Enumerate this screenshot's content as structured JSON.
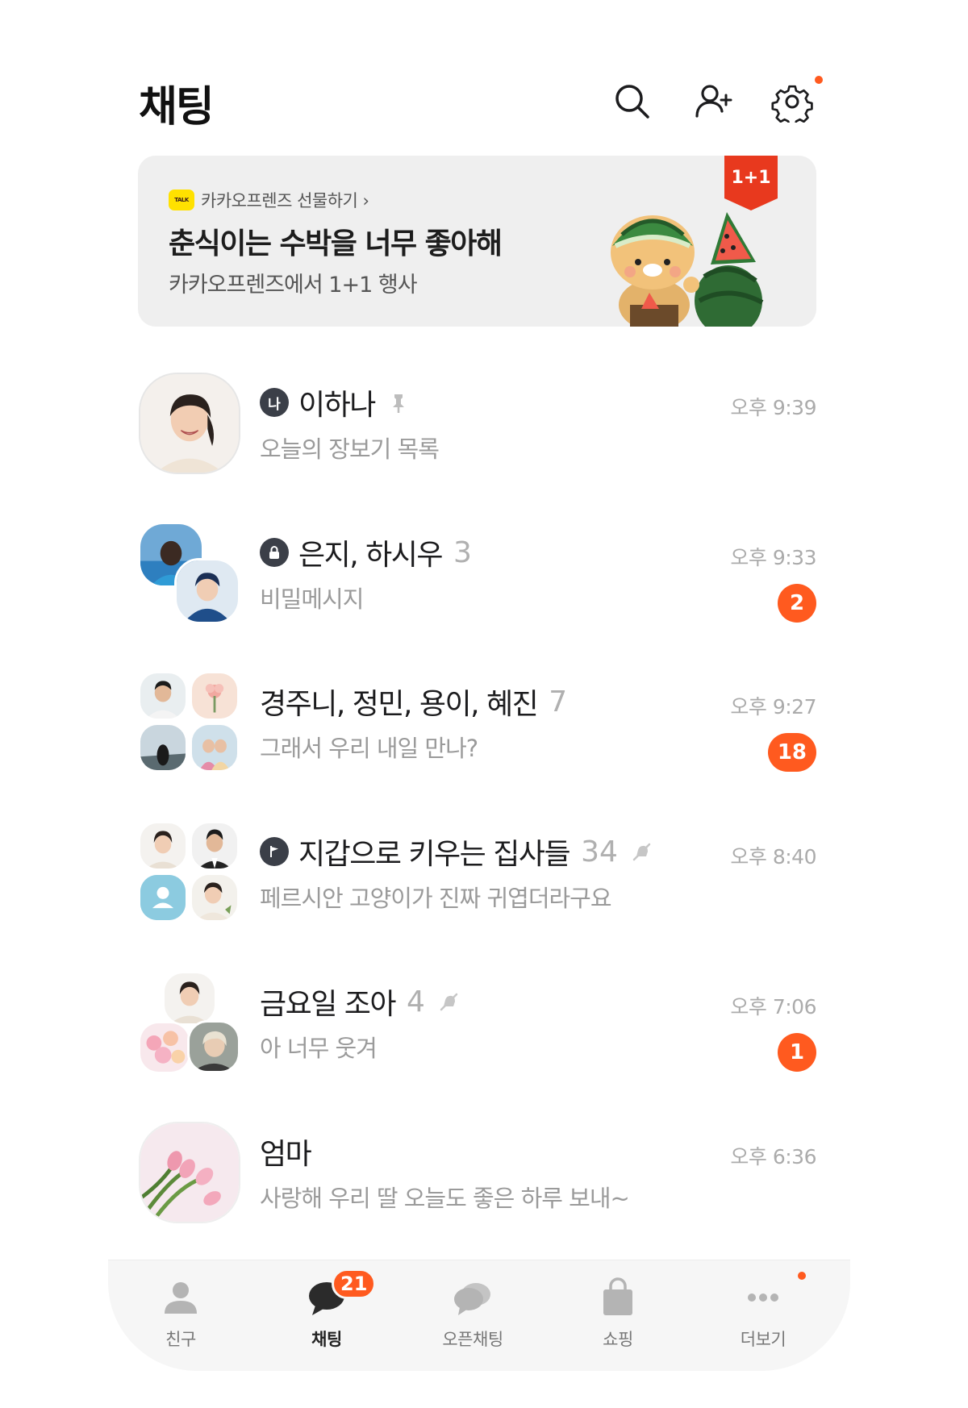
{
  "header": {
    "title": "채팅",
    "icons": [
      "search-icon",
      "add-friend-icon",
      "settings-icon"
    ]
  },
  "banner": {
    "source": "카카오프렌즈 선물하기 ›",
    "logo_text": "TALK",
    "title": "춘식이는 수박을 너무 좋아해",
    "subtitle": "카카오프렌즈에서 1+1 행사",
    "badge": "1+1"
  },
  "chats": [
    {
      "name": "이하나",
      "members": "",
      "preview": "오늘의 장보기 목록",
      "time": "오후 9:39",
      "unread": "",
      "type_icon": "나",
      "pinned": true,
      "muted": false
    },
    {
      "name": "은지, 하시우",
      "members": "3",
      "preview": "비밀메시지",
      "time": "오후 9:33",
      "unread": "2",
      "type_icon": "lock-icon",
      "pinned": false,
      "muted": false
    },
    {
      "name": "경주니, 정민, 용이, 혜진",
      "members": "7",
      "preview": "그래서 우리 내일 만나?",
      "time": "오후 9:27",
      "unread": "18",
      "type_icon": "",
      "pinned": false,
      "muted": false
    },
    {
      "name": "지갑으로 키우는 집사들",
      "members": "34",
      "preview": "페르시안 고양이가 진짜 귀엽더라구요",
      "time": "오후 8:40",
      "unread": "",
      "type_icon": "flag-icon",
      "pinned": false,
      "muted": true
    },
    {
      "name": "금요일 조아",
      "members": "4",
      "preview": "아 너무 웃겨",
      "time": "오후 7:06",
      "unread": "1",
      "type_icon": "",
      "pinned": false,
      "muted": true
    },
    {
      "name": "엄마",
      "members": "",
      "preview": "사랑해 우리 딸 오늘도 좋은 하루 보내~",
      "time": "오후 6:36",
      "unread": "",
      "type_icon": "",
      "pinned": false,
      "muted": false
    }
  ],
  "tabs": [
    {
      "label": "친구",
      "icon": "person-icon",
      "active": false
    },
    {
      "label": "채팅",
      "icon": "chat-bubble-icon",
      "active": true,
      "badge": "21"
    },
    {
      "label": "오픈채팅",
      "icon": "open-chat-icon",
      "active": false
    },
    {
      "label": "쇼핑",
      "icon": "shopping-bag-icon",
      "active": false
    },
    {
      "label": "더보기",
      "icon": "more-icon",
      "active": false
    }
  ],
  "colors": {
    "accent": "#ff5a1f",
    "kakao_yellow": "#ffe100",
    "banner_bg": "#efefef",
    "badge_red": "#e8391e"
  }
}
